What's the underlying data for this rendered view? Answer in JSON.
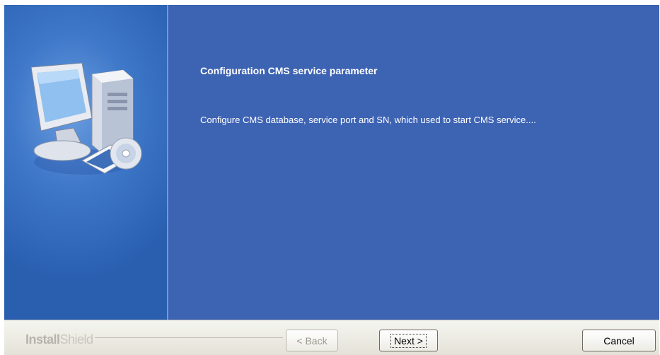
{
  "window": {
    "title": "Configuration CMS service parameter",
    "description": "Configure CMS database, service port and SN, which used to start CMS service...."
  },
  "footer": {
    "brand_part1": "Install",
    "brand_part2": "Shield",
    "back_label": "< Back",
    "next_label": "Next >",
    "cancel_label": "Cancel"
  },
  "icons": {
    "side": "computer-setup-icon"
  }
}
